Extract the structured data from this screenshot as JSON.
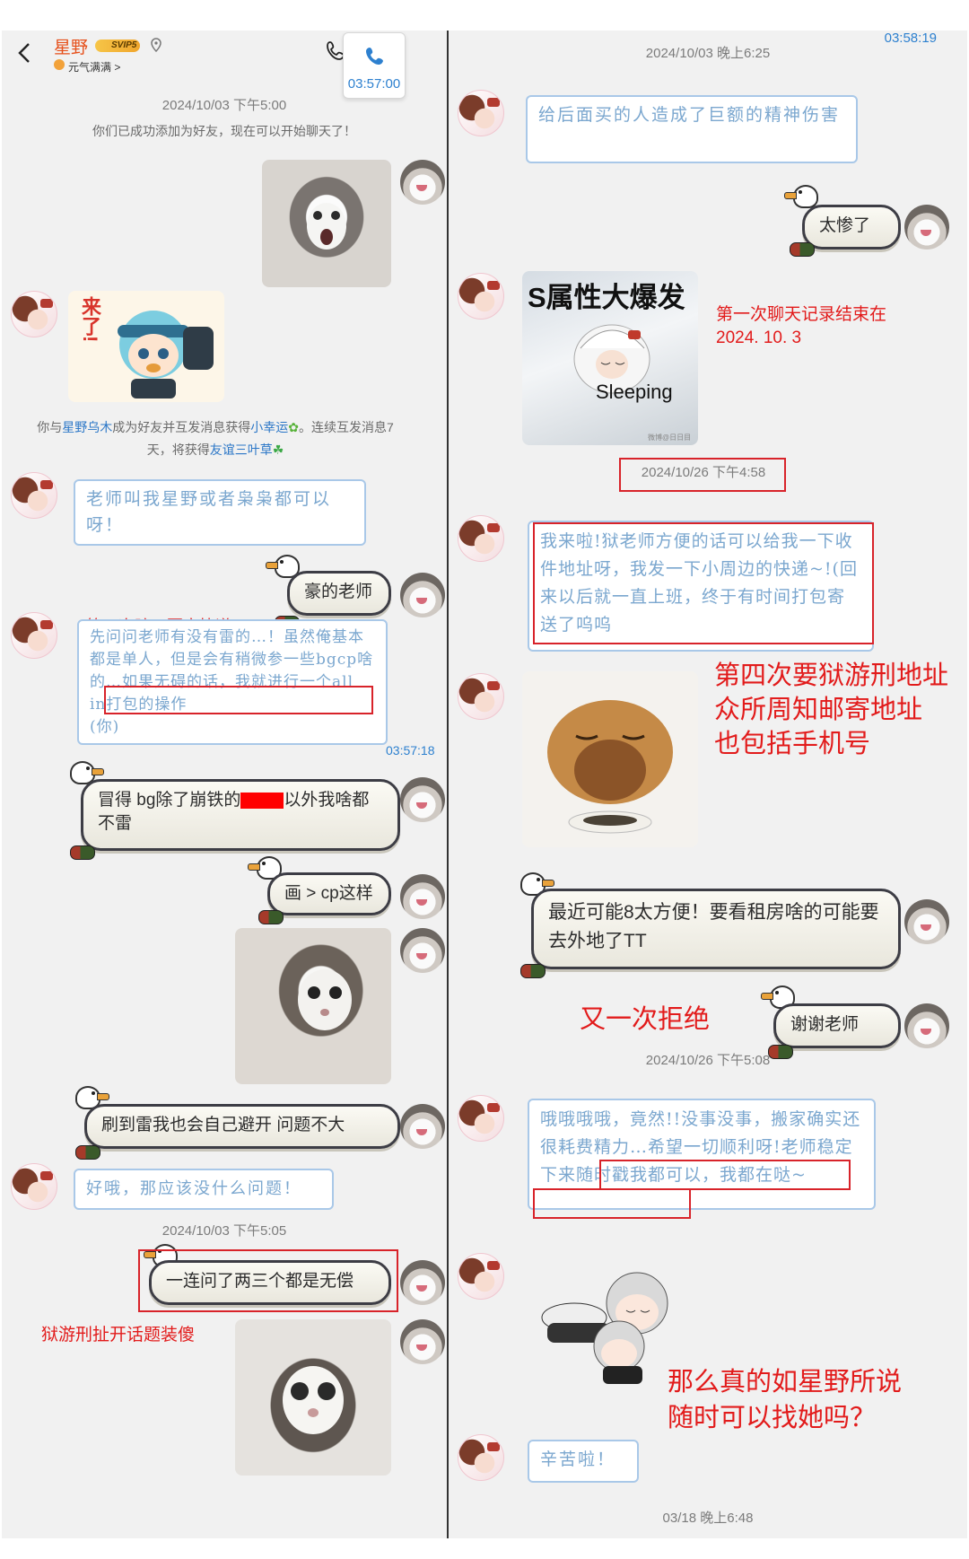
{
  "left": {
    "header": {
      "contact_name": "星野",
      "vip_badge": "SVIP5",
      "status_text": "元气满满 >",
      "call_time": "03:57:00"
    },
    "timestamps": [
      "2024/10/03 下午5:00",
      "2024/10/03 下午5:05"
    ],
    "system_added": "你们已成功添加为好友，现在可以开始聊天了！",
    "system_friend": {
      "prefix": "你与",
      "name": "星野乌木",
      "mid": "成为好友并互发消息获得",
      "badge1": "小幸运",
      "mid2": "。连续互发消息7",
      "line2_prefix": "天，将获得",
      "badge2": "友谊三叶草"
    },
    "miku_sticker_text": "来了!",
    "messages": {
      "m1": "老师叫我星野或者枭枭都可以呀！",
      "m2": "豪的老师",
      "m3_part1": "先问问老师有没有雷的…！虽然俺基本都是单人，但是会有稍微参一些bgcp啥的…如果无碍的话，",
      "m3_highlight": "我就进行一个all in打包的操作",
      "m3_end": "(你)",
      "m4": "冒得 bg除了崩铁的",
      "m4b": "以外我啥都不雷",
      "m5": "画 > cp这样",
      "m6": "刷到雷我也会自己避开 问题不大",
      "m7": "好哦，那应该没什么问题！",
      "m8": "一连问了两三个都是无偿"
    },
    "inline_time": "03:57:18",
    "annotations": {
      "a1": "第三次暗示要寄快递",
      "a2": "狱游刑扯开话题装傻"
    }
  },
  "right": {
    "corner_time": "03:58:19",
    "timestamps": [
      "2024/10/03 晚上6:25",
      "2024/10/26 下午4:58",
      "2024/10/26 下午5:08",
      "03/18 晚上6:48"
    ],
    "messages": {
      "r1": "给后面买的人造成了巨额的精神伤害",
      "r2": "太惨了",
      "r3": "我来啦!狱老师方便的话可以给我一下收件地址呀，我发一下小周边的快递~!(回来以后就一直上班，终于有时间打包寄送了呜呜",
      "r4": "最近可能8太方便！要看租房啥的可能要去外地了TT",
      "r5": "谢谢老师",
      "r6_part1": "哦哦哦哦，竟然!!没事没事，搬家确实还很耗费精力…希望一切顺利呀!",
      "r6_highlight": "老师稳定下来随时戳我都可以，我都在哒~",
      "r7": "辛苦啦！"
    },
    "sleep_sticker": {
      "top": "S属性大爆发",
      "bottom": "Sleeping",
      "wm": "微博@日日目"
    },
    "annotations": {
      "b1_line1": "第一次聊天记录结束在",
      "b1_line2": "2024. 10. 3",
      "b2_line1": "第四次要狱游刑地址",
      "b2_line2": "众所周知邮寄地址",
      "b2_line3": "也包括手机号",
      "b3": "又一次拒绝",
      "b4_line1": "那么真的如星野所说",
      "b4_line2": "随时可以找她吗？"
    }
  },
  "colors": {
    "annotation_red": "#e21b1b",
    "link_blue": "#2c77c7",
    "bubble_text": "#7ba7cf"
  }
}
